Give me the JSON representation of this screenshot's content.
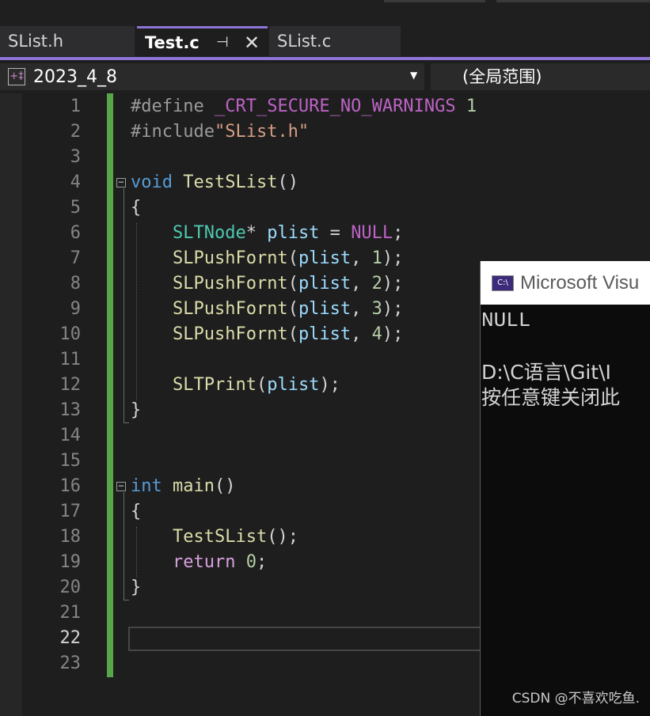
{
  "tabs": [
    {
      "label": "SList.h",
      "active": false
    },
    {
      "label": "Test.c",
      "active": true
    },
    {
      "label": "SList.c",
      "active": false
    }
  ],
  "navbar": {
    "scope_label": "2023_4_8",
    "global_label": "(全局范围)"
  },
  "editor": {
    "current_line": 22,
    "line_numbers": [
      "1",
      "2",
      "3",
      "4",
      "5",
      "6",
      "7",
      "8",
      "9",
      "10",
      "11",
      "12",
      "13",
      "14",
      "15",
      "16",
      "17",
      "18",
      "19",
      "20",
      "21",
      "22",
      "23"
    ],
    "code": {
      "l1_directive": "#define",
      "l1_macro": "_CRT_SECURE_NO_WARNINGS",
      "l1_value": "1",
      "l2_directive": "#include",
      "l2_header": "\"SList.h\"",
      "l4_keyword": "void",
      "l4_name": "TestSList",
      "l4_parens": "()",
      "l5_brace": "{",
      "l6_type": "SLTNode",
      "l6_star": "*",
      "l6_var": "plist",
      "l6_eq": " = ",
      "l6_null": "NULL",
      "l6_semi": ";",
      "push_fn": "SLPushFornt",
      "push_arg": "plist",
      "push_values": [
        "1",
        "2",
        "3",
        "4"
      ],
      "l12_fn": "SLTPrint",
      "l12_arg": "plist",
      "l13_brace": "}",
      "l16_keyword": "int",
      "l16_name": "main",
      "l16_parens": "()",
      "l17_brace": "{",
      "l18_call": "TestSList",
      "l18_rest": "();",
      "l19_keyword": "return",
      "l19_value": "0",
      "l19_semi": ";",
      "l20_brace": "}"
    }
  },
  "console": {
    "title": "Microsoft Visu",
    "icon_label": "C:\\",
    "lines": [
      "NULL",
      "",
      "D:\\C语言\\Git\\I",
      "按任意键关闭此"
    ]
  },
  "watermark": "CSDN @不喜欢吃鱼.",
  "colors": {
    "accent": "#8e74d6",
    "change_bar": "#57a64a",
    "keyword": "#569cd6",
    "function": "#dcdcaa",
    "type": "#4ec9b0",
    "variable": "#9cdcfe"
  }
}
